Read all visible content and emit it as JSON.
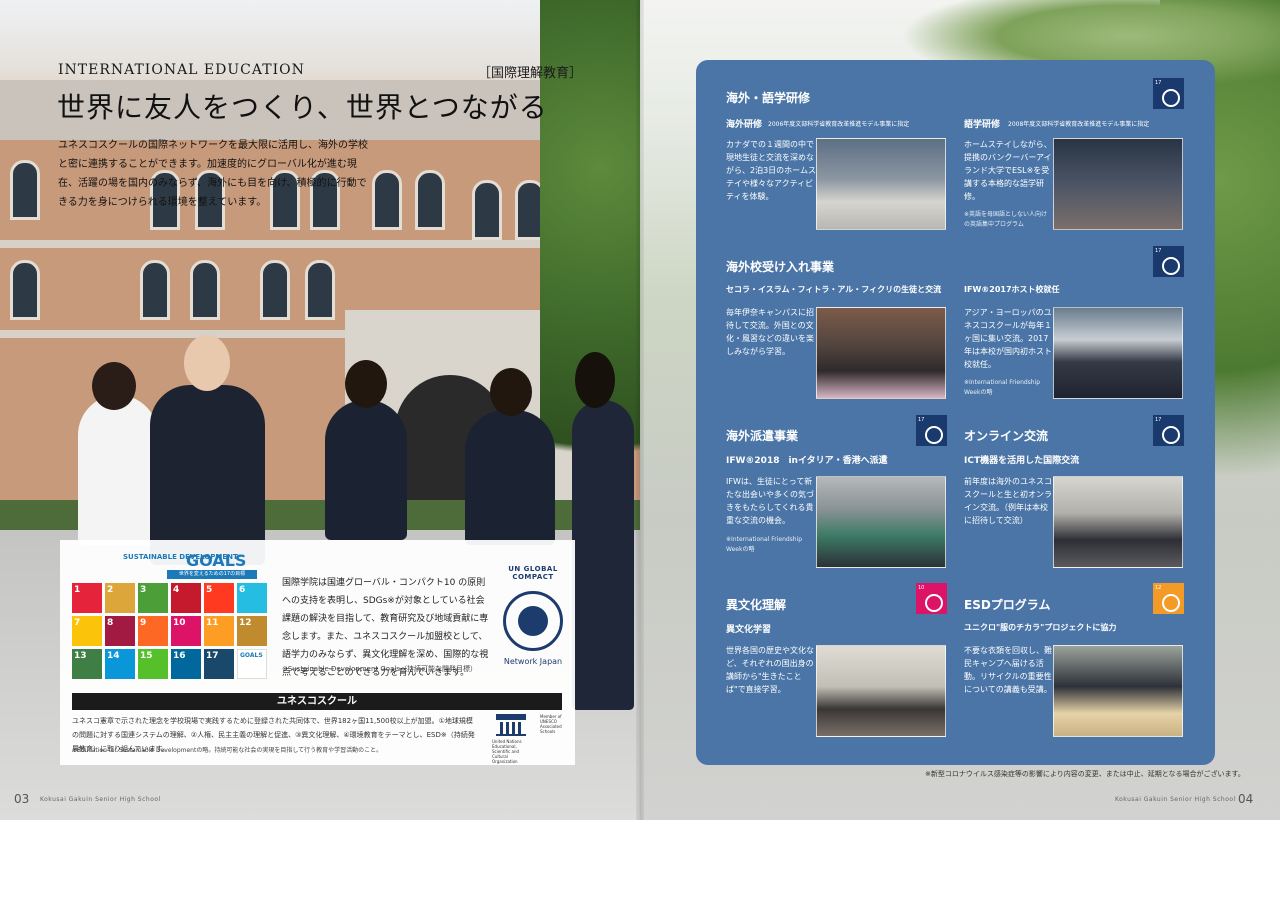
{
  "left": {
    "eyebrow": "INTERNATIONAL EDUCATION",
    "tag": "［国際理解教育］",
    "headline": "世界に友人をつくり、世界とつながる",
    "intro": "ユネスコスクールの国際ネットワークを最大限に活用し、海外の学校と密に連携することができます。加速度的にグローバル化が進む現在、活躍の場を国内のみならず、海外にも目を向け、積極的に行動できる力を身につけられる環境を整えています。",
    "sdg_logo_top": "SUSTAINABLE DEVELOPMENT",
    "sdg_logo_goals": "GOALS",
    "sdg_logo_sub": "世界を変えるための17の目標",
    "sdg_text": "国際学院は国連グローバル・コンパクト10 の原則への支持を表明し、SDGs※が対象としている社会課題の解決を目指して、教育研究及び地域貢献に専念します。また、ユネスコスクール加盟校として、語学力のみならず、異文化理解を深め、国際的な視点で考えることのできる力を育んでいきます。",
    "sdg_note": "※Sustainable Development Goals（持続可能な開発目標）",
    "ungc_top": "UN GLOBAL COMPACT",
    "ungc_bottom": "Network Japan",
    "unesco_bar": "ユネスコスクール",
    "unesco_text": "ユネスコ憲章で示された理念を学校現場で実践するために登録された共同体で、世界182ヶ国11,500校以上が加盟。①地球規模の問題に対する国連システムの理解、②人権、民主主義の理解と促進、③異文化理解、④環境教育をテーマとし、ESD※（持続発展教育）に取り組んでいます。",
    "unesco_note": "※Education for Sustainable Developmentの略。持続可能な社会の実現を目指して行う教育や学習活動のこと。",
    "unesco_caption": "United Nations Educational, Scientific and Cultural Organization",
    "unesco_member": "Member of UNESCO Associated Schools"
  },
  "sdg_tiles": [
    {
      "n": "1",
      "color": "#e5243b"
    },
    {
      "n": "2",
      "color": "#dda63a"
    },
    {
      "n": "3",
      "color": "#4c9f38"
    },
    {
      "n": "4",
      "color": "#c5192d"
    },
    {
      "n": "5",
      "color": "#ff3a21"
    },
    {
      "n": "6",
      "color": "#26bde2"
    },
    {
      "n": "7",
      "color": "#fcc30b"
    },
    {
      "n": "8",
      "color": "#a21942"
    },
    {
      "n": "9",
      "color": "#fd6925"
    },
    {
      "n": "10",
      "color": "#dd1367"
    },
    {
      "n": "11",
      "color": "#fd9d24"
    },
    {
      "n": "12",
      "color": "#bf8b2e"
    },
    {
      "n": "13",
      "color": "#3f7e44"
    },
    {
      "n": "14",
      "color": "#0a97d9"
    },
    {
      "n": "15",
      "color": "#56c02b"
    },
    {
      "n": "16",
      "color": "#00689d"
    },
    {
      "n": "17",
      "color": "#19486a"
    }
  ],
  "right": {
    "s1_title": "海外・語学研修",
    "s1a_head": "海外研修",
    "s1a_sub": "2006年度文部科学省教育改革推進モデル事業に指定",
    "s1a_text": "カナダでの１週間の中で現地生徒と交流を深めながら、2泊3日のホームステイや様々なアクティビティを体験。",
    "s1b_head": "語学研修",
    "s1b_sub": "2008年度文部科学省教育改革推進モデル事業に指定",
    "s1b_text": "ホームステイしながら、提携のバンクーバーアイランド大学でESL※を受講する本格的な語学研修。",
    "s1b_note": "※英語を母国語としない人向けの英語集中プログラム",
    "s2_title": "海外校受け入れ事業",
    "s2a_head": "セコラ・イスラム・フィトラ・アル・フィクリの生徒と交流",
    "s2a_text": "毎年伊奈キャンパスに招待して交流。外国との文化・風習などの違いを楽しみながら学習。",
    "s2b_head": "IFW®2017ホスト校就任",
    "s2b_text": "アジア・ヨーロッパのユネスコスクールが毎年１ヶ国に集い交流。2017年は本校が国内初ホスト校就任。",
    "s2b_note": "※International Friendship Weekの略",
    "s3_title": "海外派遣事業",
    "s3_head": "IFW®2018　inイタリア・香港へ派遣",
    "s3_text": "IFWは、生徒にとって新たな出会いや多くの気づきをもたらしてくれる貴重な交流の機会。",
    "s3_note": "※International Friendship Weekの略",
    "s4_title": "オンライン交流",
    "s4_head": "ICT機器を活用した国際交流",
    "s4_text": "前年度は海外のユネスコスクールと生と初オンライン交流。（例年は本校に招待して交流）",
    "s5_title": "異文化理解",
    "s5_head": "異文化学習",
    "s5_text": "世界各国の歴史や文化など、それぞれの国出身の講師から\"生きたことば\"で直接学習。",
    "s6_title": "ESDプログラム",
    "s6_head": "ユニクロ\"服のチカラ\"プロジェクトに協力",
    "s6_text": "不要な衣類を回収し、難民キャンプへ届ける活動。リサイクルの重要性についての講義も受講。",
    "badge_num": "17",
    "badge_num_10": "10",
    "badge_num_12": "12",
    "covid_note": "※新型コロナウイルス感染症等の影響により内容の変更、または中止、延期となる場合がございます。"
  },
  "footer": {
    "left_num": "03",
    "left_name": "Kokusai Gakuin Senior High School",
    "right_name": "Kokusai Gakuin Senior High School",
    "right_num": "04"
  }
}
